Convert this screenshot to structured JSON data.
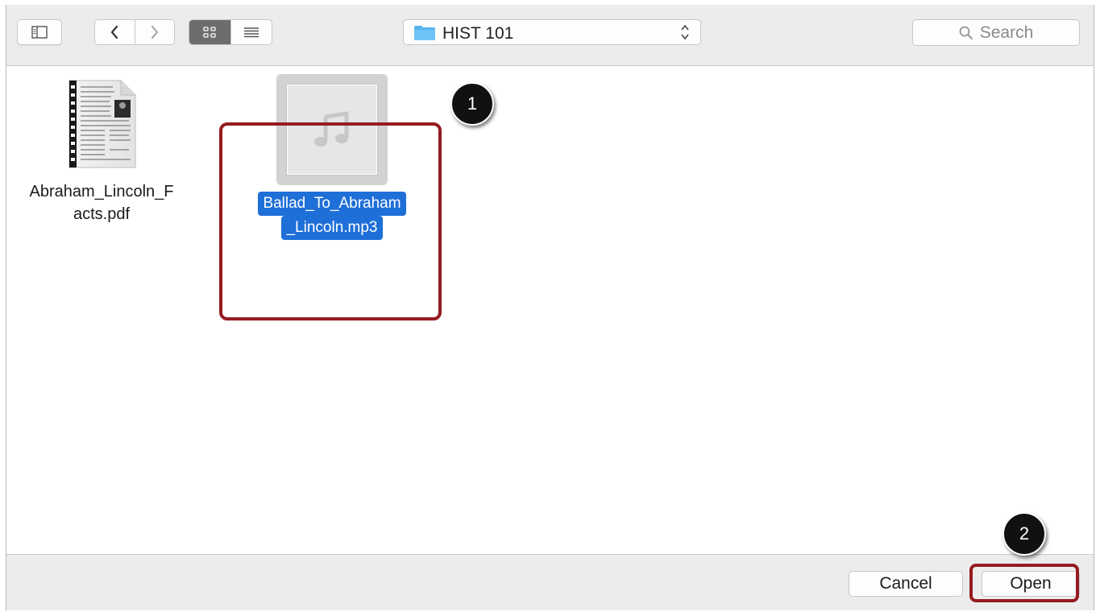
{
  "toolbar": {
    "sidebar_toggle_icon": "sidebar-icon",
    "back_icon": "chevron-left-icon",
    "forward_icon": "chevron-right-icon",
    "icon_view_icon": "grid-icon",
    "list_view_icon": "list-icon",
    "location": {
      "folder_icon": "folder-icon",
      "name": "HIST 101",
      "stepper_icon": "up-down-chevron-icon"
    },
    "search": {
      "icon": "search-icon",
      "placeholder": "Search"
    }
  },
  "files": [
    {
      "name": "Abraham_Lincoln_F\nacts.pdf",
      "line1": "Abraham_Lincoln_F",
      "line2": "acts.pdf",
      "icon": "pdf-document-icon",
      "selected": false
    },
    {
      "name": "Ballad_To_Abraham_Lincoln.mp3",
      "line1": "Ballad_To_Abraham",
      "line2": "_Lincoln.mp3",
      "icon": "music-note-icon",
      "selected": true
    }
  ],
  "callouts": [
    {
      "label": "1"
    },
    {
      "label": "2"
    }
  ],
  "footer": {
    "cancel_label": "Cancel",
    "open_label": "Open"
  },
  "colors": {
    "selection": "#1f6fd8",
    "callout_border": "#951c20",
    "badge": "#111111"
  }
}
